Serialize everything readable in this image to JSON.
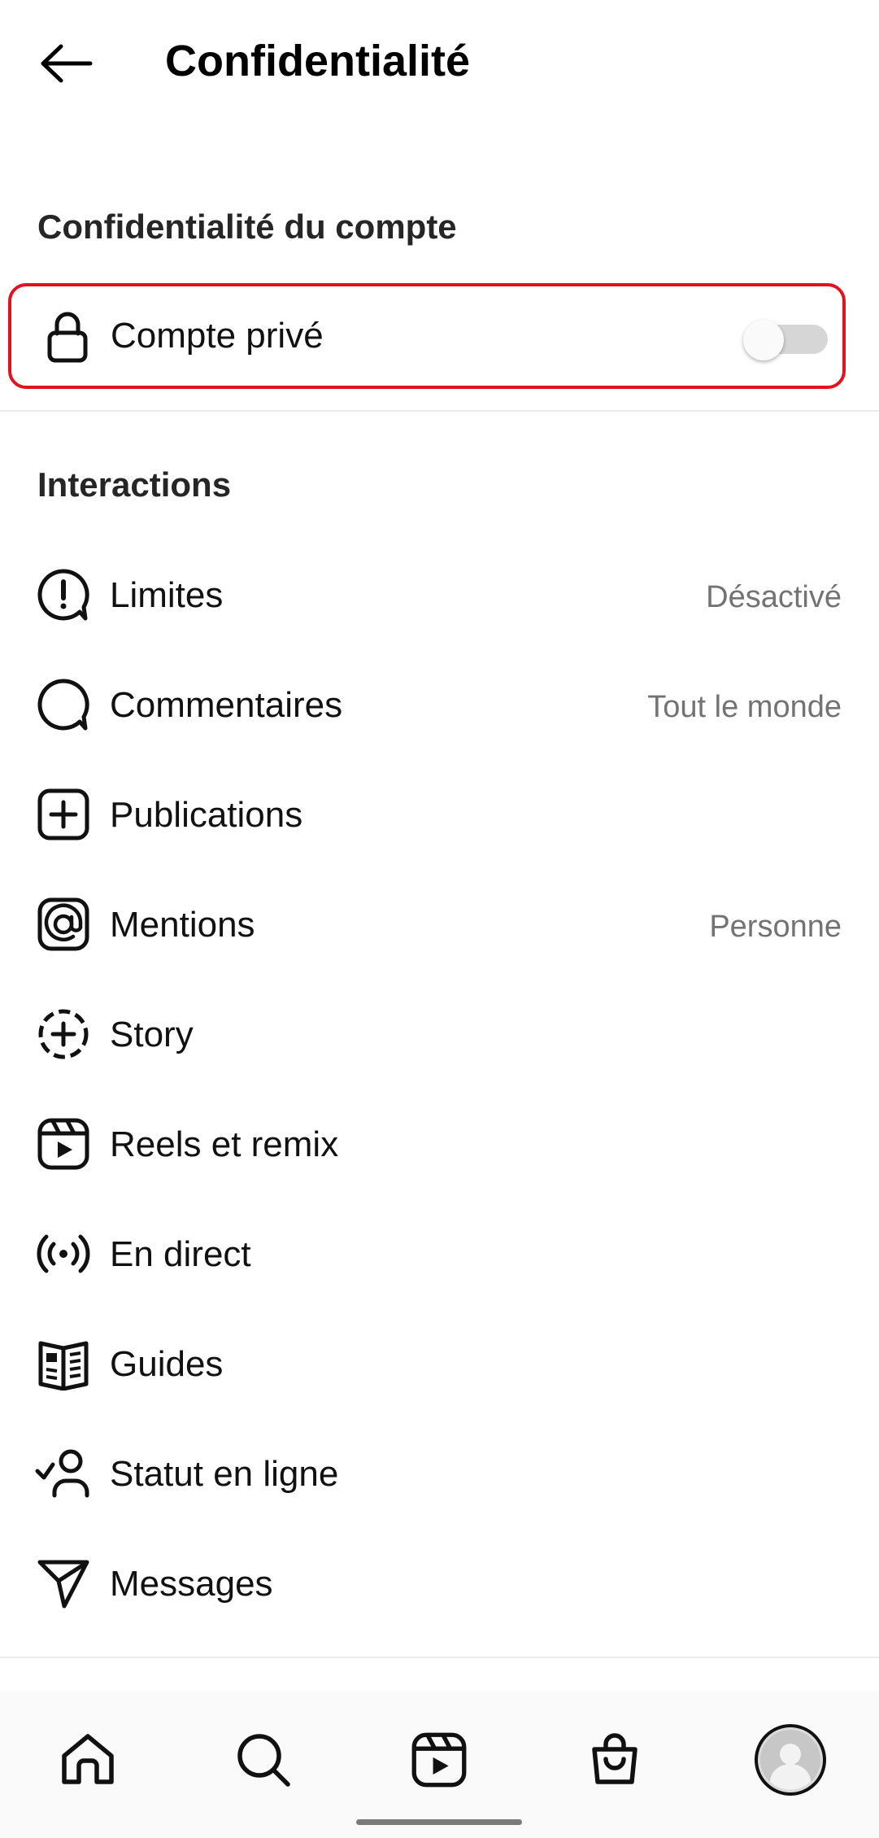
{
  "header": {
    "title": "Confidentialité",
    "back_icon": "arrow-left-icon"
  },
  "account_section": {
    "title": "Confidentialité du compte",
    "private_account": {
      "label": "Compte privé",
      "icon": "lock-icon",
      "enabled": false
    }
  },
  "interactions_section": {
    "title": "Interactions",
    "items": [
      {
        "label": "Limites",
        "value": "Désactivé",
        "icon": "limits-alert-icon"
      },
      {
        "label": "Commentaires",
        "value": "Tout le monde",
        "icon": "comment-bubble-icon"
      },
      {
        "label": "Publications",
        "value": "",
        "icon": "plus-square-icon"
      },
      {
        "label": "Mentions",
        "value": "Personne",
        "icon": "at-sign-icon"
      },
      {
        "label": "Story",
        "value": "",
        "icon": "story-plus-dashed-icon"
      },
      {
        "label": "Reels et remix",
        "value": "",
        "icon": "reels-icon"
      },
      {
        "label": "En direct",
        "value": "",
        "icon": "live-broadcast-icon"
      },
      {
        "label": "Guides",
        "value": "",
        "icon": "guides-book-icon"
      },
      {
        "label": "Statut en ligne",
        "value": "",
        "icon": "online-status-user-icon"
      },
      {
        "label": "Messages",
        "value": "",
        "icon": "paper-plane-icon"
      }
    ]
  },
  "bottom_nav": {
    "items": [
      {
        "icon": "home-icon"
      },
      {
        "icon": "search-icon"
      },
      {
        "icon": "reels-icon"
      },
      {
        "icon": "shop-bag-icon"
      },
      {
        "icon": "profile-avatar-icon"
      }
    ]
  },
  "colors": {
    "highlight_border": "#e0131f",
    "secondary_text": "#737373",
    "toggle_track": "#d6d6d6"
  }
}
